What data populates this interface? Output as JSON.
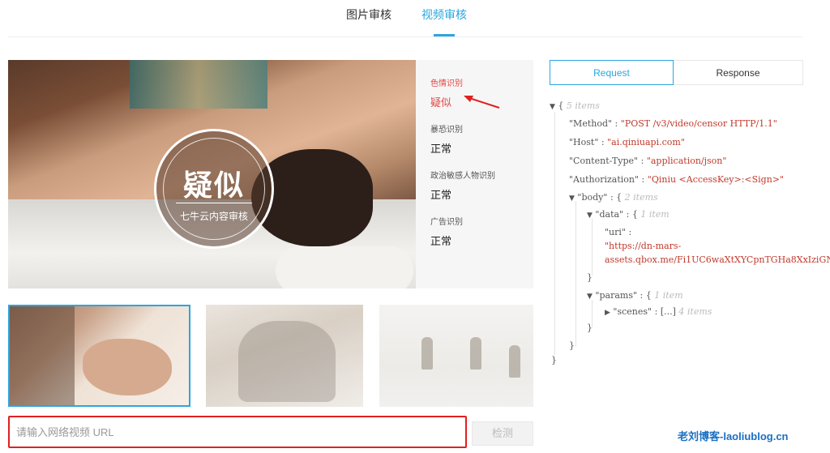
{
  "tabs": [
    {
      "label": "图片审核"
    },
    {
      "label": "视频审核"
    }
  ],
  "badge": {
    "title": "疑似",
    "subtitle": "七牛云内容审核"
  },
  "results": [
    {
      "label": "色情识别",
      "value": "疑似",
      "highlight_color": "#e54545"
    },
    {
      "label": "暴恐识别",
      "value": "正常"
    },
    {
      "label": "政治敏感人物识别",
      "value": "正常"
    },
    {
      "label": "广告识别",
      "value": "正常"
    }
  ],
  "url_input": {
    "placeholder": "请输入网络视频 URL"
  },
  "detect_button": {
    "label": "检测"
  },
  "segmented": {
    "request": "Request",
    "response": "Response"
  },
  "json": {
    "root_count": "5 items",
    "method_key": "\"Method\"",
    "method_val": "\"POST /v3/video/censor HTTP/1.1\"",
    "host_key": "\"Host\"",
    "host_val": "\"ai.qiniuapi.com\"",
    "ctype_key": "\"Content-Type\"",
    "ctype_val": "\"application/json\"",
    "auth_key": "\"Authorization\"",
    "auth_val": "\"Qiniu <AccessKey>:<Sign>\"",
    "body_key": "\"body\"",
    "body_count": "2 items",
    "data_key": "\"data\"",
    "data_count": "1 item",
    "uri_key": "\"uri\"",
    "uri_val_1": "\"https://dn-mars-",
    "uri_val_2": "assets.qbox.me/Fi1UC6waXtXYCpnTGHa8XxIziGN",
    "params_key": "\"params\"",
    "params_count": "1 item",
    "scenes_key": "\"scenes\"",
    "scenes_val": "[...]",
    "scenes_count": "4 items"
  },
  "watermark": "老刘博客-laoliublog.cn",
  "colors": {
    "accent": "#2ba6df",
    "alert": "#e02020",
    "string": "#c0392b"
  }
}
